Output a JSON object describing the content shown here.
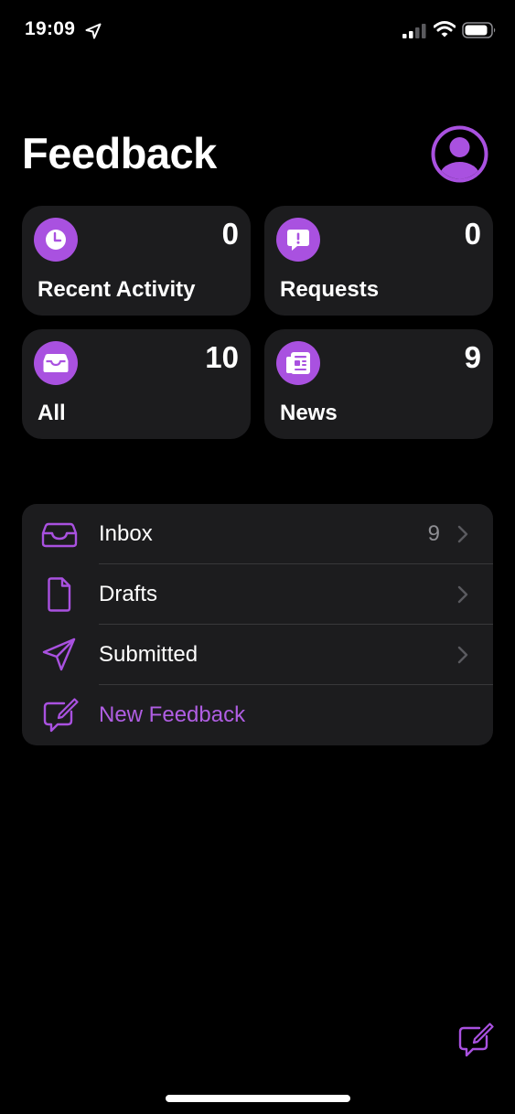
{
  "status_bar": {
    "time": "19:09"
  },
  "header": {
    "title": "Feedback"
  },
  "tiles": [
    {
      "label": "Recent Activity",
      "count": "0",
      "icon": "clock-icon"
    },
    {
      "label": "Requests",
      "count": "0",
      "icon": "exclamation-bubble-icon"
    },
    {
      "label": "All",
      "count": "10",
      "icon": "tray-icon"
    },
    {
      "label": "News",
      "count": "9",
      "icon": "newspaper-icon"
    }
  ],
  "list": [
    {
      "label": "Inbox",
      "count": "9",
      "icon": "tray-icon"
    },
    {
      "label": "Drafts",
      "count": "",
      "icon": "document-icon"
    },
    {
      "label": "Submitted",
      "count": "",
      "icon": "paper-plane-icon"
    },
    {
      "label": "New Feedback",
      "icon": "compose-icon"
    }
  ],
  "colors": {
    "background": "#000000",
    "card": "#1c1c1e",
    "accent": "#a951e0",
    "secondary_text": "#8e8e93",
    "separator": "#38383a"
  }
}
